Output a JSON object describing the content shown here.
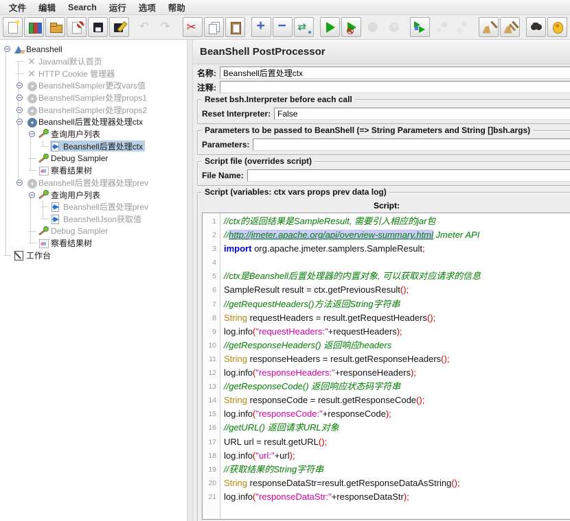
{
  "menu": {
    "items": [
      "文件",
      "编辑",
      "Search",
      "运行",
      "选项",
      "帮助"
    ]
  },
  "toolbar": {
    "buttons": [
      {
        "name": "new-file",
        "enabled": true
      },
      {
        "name": "templates",
        "enabled": true
      },
      {
        "name": "open-file",
        "enabled": true
      },
      {
        "name": "close-file",
        "enabled": true
      },
      {
        "name": "save",
        "enabled": true
      },
      {
        "name": "save-as",
        "enabled": true
      },
      {
        "gap": true
      },
      {
        "name": "undo",
        "enabled": false
      },
      {
        "name": "redo",
        "enabled": false
      },
      {
        "gap": true
      },
      {
        "name": "cut",
        "enabled": true
      },
      {
        "name": "copy",
        "enabled": true
      },
      {
        "name": "paste",
        "enabled": true
      },
      {
        "gap": true
      },
      {
        "name": "add",
        "enabled": true
      },
      {
        "name": "remove",
        "enabled": true
      },
      {
        "name": "toggle",
        "enabled": true
      },
      {
        "gap": true
      },
      {
        "name": "start",
        "enabled": true
      },
      {
        "name": "start-no-pauses",
        "enabled": true
      },
      {
        "name": "stop",
        "enabled": false
      },
      {
        "name": "shutdown",
        "enabled": false
      },
      {
        "gap": true
      },
      {
        "name": "remote-start-all",
        "enabled": true
      },
      {
        "name": "remote-stop-all",
        "enabled": false
      },
      {
        "name": "remote-shutdown-all",
        "enabled": false
      },
      {
        "gap": true
      },
      {
        "name": "clear",
        "enabled": true
      },
      {
        "name": "clear-all",
        "enabled": true
      },
      {
        "gap": true
      },
      {
        "name": "search",
        "enabled": true
      },
      {
        "name": "search-reset",
        "enabled": true
      }
    ]
  },
  "tree": {
    "items": [
      {
        "label": "Beanshell",
        "level": 0,
        "icon": "test-plan",
        "enabled": true,
        "handle": true
      },
      {
        "label": "Javamal默认首页",
        "level": 1,
        "icon": "disabled-x",
        "enabled": false
      },
      {
        "label": "HTTP Cookie 管理器",
        "level": 1,
        "icon": "disabled-x",
        "enabled": false
      },
      {
        "label": "BeanshellSampler更改vars值",
        "level": 1,
        "icon": "gear",
        "enabled": false,
        "handle": true
      },
      {
        "label": "BeanshellSampler处理props1",
        "level": 1,
        "icon": "gear",
        "enabled": false,
        "handle": true
      },
      {
        "label": "BeanshellSampler处理props2",
        "level": 1,
        "icon": "gear",
        "enabled": false,
        "handle": true
      },
      {
        "label": "Beanshell后置处理器处理ctx",
        "level": 1,
        "icon": "gear-active",
        "enabled": true,
        "handle": true
      },
      {
        "label": "查询用户列表",
        "level": 2,
        "icon": "sampler",
        "enabled": true,
        "handle": true
      },
      {
        "label": "Beanshell后置处理ctx",
        "level": 3,
        "icon": "postprocessor",
        "enabled": true,
        "selected": true
      },
      {
        "label": "Debug Sampler",
        "level": 2,
        "icon": "sampler",
        "enabled": true
      },
      {
        "label": "察看结果树",
        "level": 2,
        "icon": "results-tree",
        "enabled": true
      },
      {
        "label": "Beanshell后置处理器处理prev",
        "level": 1,
        "icon": "gear",
        "enabled": false,
        "handle": true
      },
      {
        "label": "查询用户列表",
        "level": 2,
        "icon": "sampler",
        "enabled": true,
        "handle": true
      },
      {
        "label": "Beanshell后置处理prev",
        "level": 3,
        "icon": "postprocessor",
        "enabled": false
      },
      {
        "label": "BeanshellJson获取值",
        "level": 3,
        "icon": "postprocessor",
        "enabled": false
      },
      {
        "label": "Debug Sampler",
        "level": 2,
        "icon": "sampler",
        "enabled": false
      },
      {
        "label": "察看结果树",
        "level": 2,
        "icon": "results-tree",
        "enabled": true
      },
      {
        "label": "工作台",
        "level": 0,
        "icon": "workbench",
        "enabled": true
      }
    ]
  },
  "panel": {
    "title": "BeanShell PostProcessor",
    "name_label": "名称:",
    "name_value": "Beanshell后置处理ctx",
    "comment_label": "注释:",
    "comment_value": "",
    "reset": {
      "legend": "Reset bsh.Interpreter before each call",
      "field_label": "Reset Interpreter:",
      "value": "False"
    },
    "params": {
      "legend": "Parameters to be passed to BeanShell (=> String Parameters and String []bsh.args)",
      "field_label": "Parameters:",
      "value": ""
    },
    "file": {
      "legend": "Script file (overrides script)",
      "field_label": "File Name:",
      "value": ""
    },
    "script": {
      "legend": "Script (variables: ctx vars props prev data log)",
      "label": "Script:"
    }
  },
  "editor": {
    "lines": [
      [
        [
          "c",
          "//ctx的返回结果是SampleResult, 需要引入相应的jar包"
        ]
      ],
      [
        [
          "c",
          "//"
        ],
        [
          "u",
          "http://jmeter.apache.org/api/overview-summary.html"
        ],
        [
          "c",
          " Jmeter API"
        ]
      ],
      [
        [
          "k",
          "import"
        ],
        [
          "p",
          " org.apache.jmeter.samplers.SampleResult"
        ],
        [
          "o",
          ";"
        ]
      ],
      [],
      [
        [
          "c",
          "//ctx是Beanshell后置处理器的内置对象, 可以获取对应请求的信息"
        ]
      ],
      [
        [
          "p",
          "SampleResult result = ctx.getPreviousResult"
        ],
        [
          "o",
          "();"
        ]
      ],
      [
        [
          "c",
          "//getRequestHeaders()方法返回String字符串"
        ]
      ],
      [
        [
          "t",
          "String"
        ],
        [
          "p",
          " requestHeaders = result.getRequestHeaders"
        ],
        [
          "o",
          "();"
        ]
      ],
      [
        [
          "p",
          "log.info"
        ],
        [
          "o",
          "("
        ],
        [
          "s",
          "\"requestHeaders:\""
        ],
        [
          "p",
          "+requestHeaders"
        ],
        [
          "o",
          ");"
        ]
      ],
      [
        [
          "c",
          "//getResponseHeaders() 返回响应headers"
        ]
      ],
      [
        [
          "t",
          "String"
        ],
        [
          "p",
          " responseHeaders = result.getResponseHeaders"
        ],
        [
          "o",
          "();"
        ]
      ],
      [
        [
          "p",
          "log.info"
        ],
        [
          "o",
          "("
        ],
        [
          "s",
          "\"responseHeaders:\""
        ],
        [
          "p",
          "+responseHeaders"
        ],
        [
          "o",
          ");"
        ]
      ],
      [
        [
          "c",
          "//getResponseCode() 返回响应状态码字符串"
        ]
      ],
      [
        [
          "t",
          "String"
        ],
        [
          "p",
          " responseCode = result.getResponseCode"
        ],
        [
          "o",
          "();"
        ]
      ],
      [
        [
          "p",
          "log.info"
        ],
        [
          "o",
          "("
        ],
        [
          "s",
          "\"responseCode:\""
        ],
        [
          "p",
          "+responseCode"
        ],
        [
          "o",
          ");"
        ]
      ],
      [
        [
          "c",
          "//getURL() 返回请求URL对象"
        ]
      ],
      [
        [
          "p",
          "URL url = result.getURL"
        ],
        [
          "o",
          "();"
        ]
      ],
      [
        [
          "p",
          "log.info"
        ],
        [
          "o",
          "("
        ],
        [
          "s",
          "\"url:\""
        ],
        [
          "p",
          "+url"
        ],
        [
          "o",
          ");"
        ]
      ],
      [
        [
          "c",
          "//获取结果的String字符串"
        ]
      ],
      [
        [
          "t",
          "String"
        ],
        [
          "p",
          " responseDataStr=result.getResponseDataAsString"
        ],
        [
          "o",
          "();"
        ]
      ],
      [
        [
          "p",
          "log.info"
        ],
        [
          "o",
          "("
        ],
        [
          "s",
          "\"responseDataStr:\""
        ],
        [
          "p",
          "+responseDataStr"
        ],
        [
          "o",
          ");"
        ]
      ]
    ]
  },
  "colors": {
    "selection": "#b8cfe8",
    "comment": "#007d00",
    "keyword": "#0000d2",
    "type": "#b8860b",
    "string": "#d400a6",
    "operator": "#cc0000",
    "url_highlight": "#ccccfe"
  }
}
